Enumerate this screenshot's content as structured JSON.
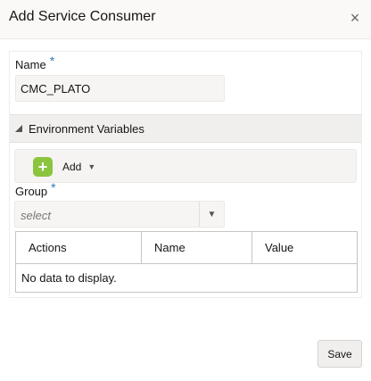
{
  "dialog": {
    "title": "Add Service Consumer",
    "close_glyph": "×"
  },
  "form": {
    "name_label": "Name",
    "name_required": "*",
    "name_value": "CMC_PLATO",
    "env_section_title": "Environment Variables",
    "add_label": "Add",
    "group_label": "Group",
    "group_required": "*",
    "group_placeholder": "select"
  },
  "table": {
    "columns": [
      "Actions",
      "Name",
      "Value"
    ],
    "empty_message": "No data to display."
  },
  "footer": {
    "save_label": "Save"
  },
  "icons": {
    "close": "close-icon",
    "collapse": "triangle-down-icon",
    "add": "plus-icon",
    "dropdown": "chevron-down-icon"
  },
  "colors": {
    "required": "#2a7ab6",
    "add_icon": "#8bc53f"
  }
}
